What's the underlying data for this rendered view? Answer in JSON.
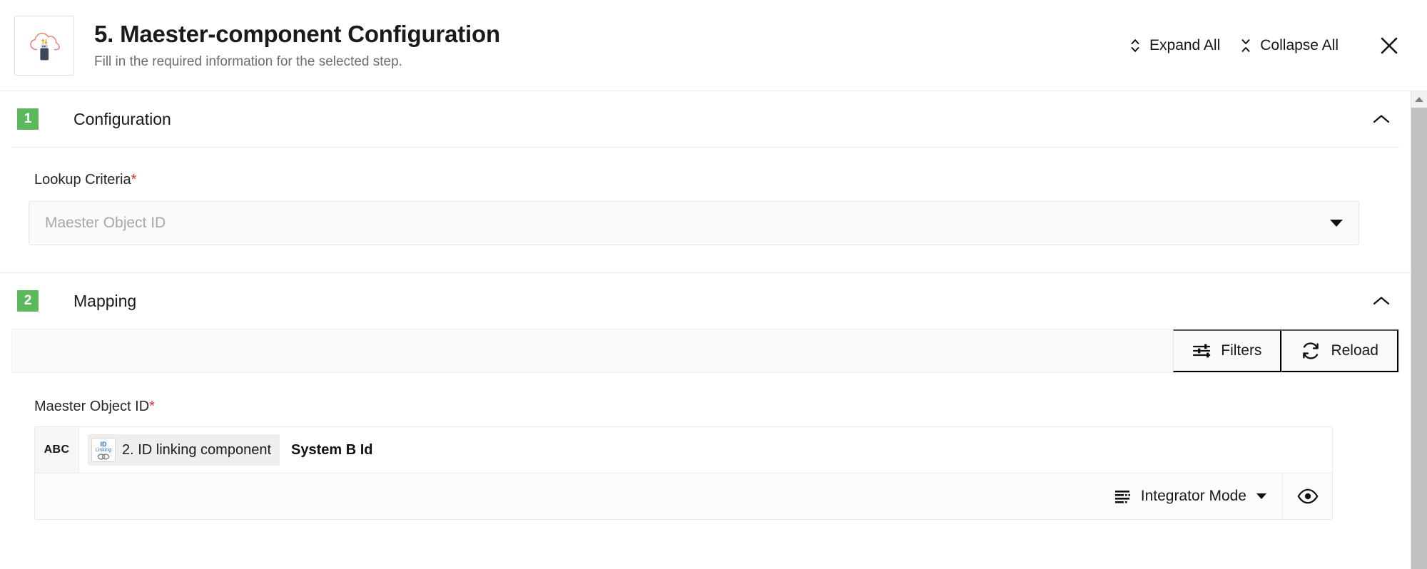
{
  "header": {
    "icon_name": "cloud-usb-icon",
    "title": "5. Maester-component Configuration",
    "subtitle": "Fill in the required information for the selected step.",
    "expand_all_label": "Expand All",
    "collapse_all_label": "Collapse All",
    "close_label": "✕"
  },
  "sections": [
    {
      "number": "1",
      "title": "Configuration",
      "expanded": true,
      "field": {
        "label": "Lookup Criteria",
        "required_marker": "*",
        "placeholder": "Maester Object ID",
        "value": ""
      }
    },
    {
      "number": "2",
      "title": "Mapping",
      "expanded": true,
      "toolbar": {
        "filters_label": "Filters",
        "reload_label": "Reload"
      },
      "mapping": {
        "label": "Maester Object ID",
        "required_marker": "*",
        "type_cell": "ABC",
        "chip": {
          "icon_id_text": "ID",
          "icon_linking_text": "Linking",
          "label": "2. ID linking component",
          "value": "System B Id"
        },
        "mode_label": "Integrator Mode",
        "visibility_icon_name": "eye-icon"
      }
    }
  ],
  "colors": {
    "badge_green": "#5cb85c",
    "required_red": "#e03131",
    "icon_blue": "#2d6cb5",
    "cloud_coral": "#e8897c",
    "usb_navy": "#3c4858"
  },
  "scrollbar": {
    "position": "right",
    "at_top": true
  }
}
